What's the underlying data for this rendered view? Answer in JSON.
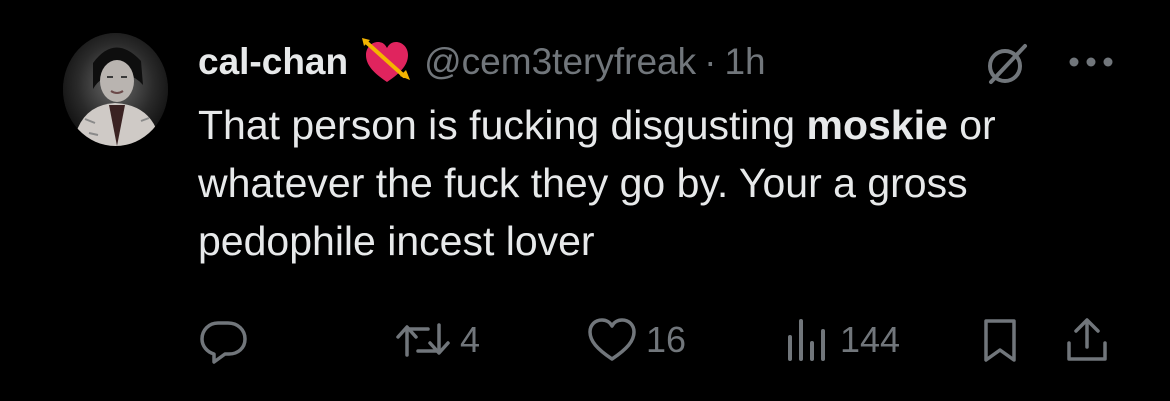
{
  "author": {
    "display_name": "cal-chan",
    "handle": "@cem3teryfreak",
    "separator": "·",
    "time": "1h",
    "badge_icon": "heart-with-arrow-icon"
  },
  "post": {
    "text_before": "That person is fucking disgusting ",
    "mention": "moskie",
    "text_after": " or whatever the fuck they go by. Your a gross pedophile incest lover"
  },
  "actions": {
    "reply": {
      "icon": "reply-icon",
      "count": ""
    },
    "repost": {
      "icon": "repost-icon",
      "count": "4"
    },
    "like": {
      "icon": "heart-icon",
      "count": "16"
    },
    "views": {
      "icon": "views-icon",
      "count": "144"
    },
    "bookmark": {
      "icon": "bookmark-icon"
    },
    "share": {
      "icon": "share-icon"
    }
  },
  "colors": {
    "background": "#000000",
    "primary_text": "#e7e9ea",
    "secondary_text": "#71767b",
    "badge_heart": "#e0245e",
    "badge_arrow": "#f4b400"
  }
}
